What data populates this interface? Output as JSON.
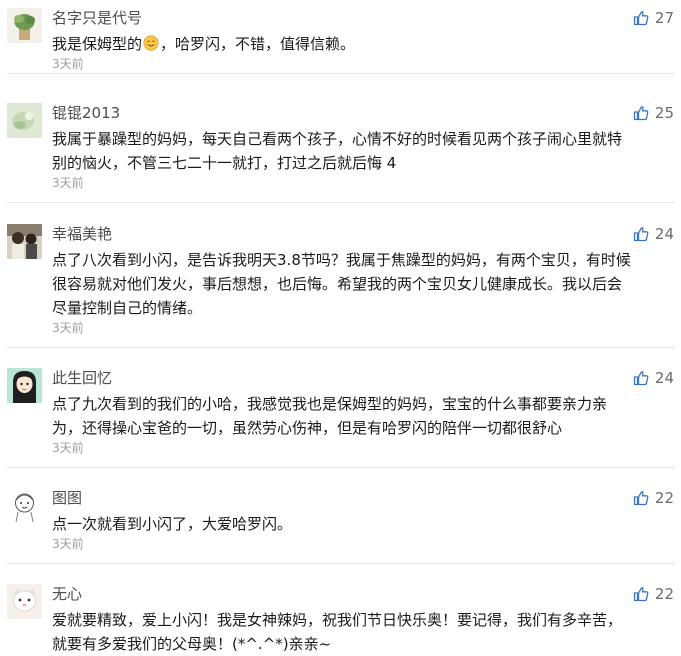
{
  "comments": [
    {
      "username": "名字只是代号",
      "lines": [
        "我是保姆型的",
        "，哈罗闪，不错，值得信赖。"
      ],
      "emoji": "smile-emoji",
      "time": "3天前",
      "likes": "27"
    },
    {
      "username": "锟锟2013",
      "lines": [
        "我属于暴躁型的妈妈，每天自己看两个孩子，心情不好的时候看见两个孩子闹心里就特",
        "别的恼火，不管三七二十一就打，打过之后就后悔 4"
      ],
      "time": "3天前",
      "likes": "25"
    },
    {
      "username": "幸福美艳",
      "lines": [
        "点了八次看到小闪，是告诉我明天3.8节吗？我属于焦躁型的妈妈，有两个宝贝，有时候",
        "很容易就对他们发火，事后想想，也后悔。希望我的两个宝贝女儿健康成长。我以后会",
        "尽量控制自己的情绪。"
      ],
      "time": "3天前",
      "likes": "24"
    },
    {
      "username": "此生回忆",
      "lines": [
        "点了九次看到的我们的小哈，我感觉我也是保姆型的妈妈，宝宝的什么事都要亲力亲",
        "为，还得操心宝爸的一切，虽然劳心伤神，但是有哈罗闪的陪伴一切都很舒心"
      ],
      "time": "3天前",
      "likes": "24"
    },
    {
      "username": "图图",
      "lines": [
        "点一次就看到小闪了，大爱哈罗闪。"
      ],
      "time": "3天前",
      "likes": "22"
    },
    {
      "username": "无心",
      "lines": [
        "爱就要精致，爱上小闪！我是女神辣妈，祝我们节日快乐奥！要记得，我们有多辛苦，",
        "就要有多爱我们的父母奥！(*^.^*)亲亲~"
      ],
      "time": "",
      "likes": "22"
    }
  ],
  "colors": {
    "username": "#4d4d4d",
    "body": "#1a1a1a",
    "time": "#a0a0a0",
    "like_icon": "#3b73c8",
    "divider": "#e6e6e6"
  },
  "icons": {
    "like": "thumbs-up-icon"
  }
}
